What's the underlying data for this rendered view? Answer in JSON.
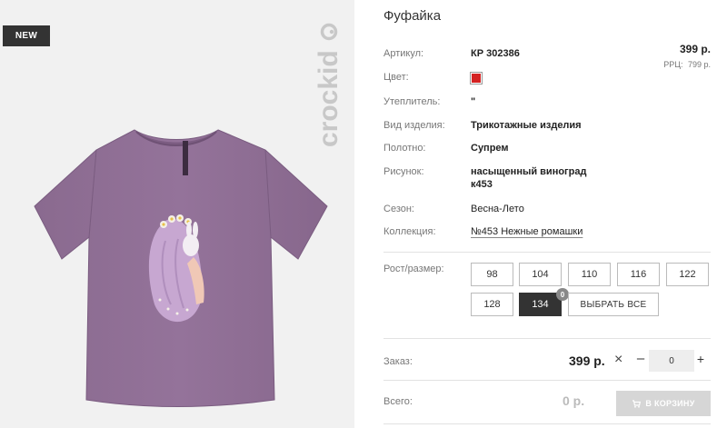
{
  "product": {
    "badge": "NEW",
    "brand": "crockid",
    "title": "Фуфайка",
    "price": "399 р.",
    "rrp_label": "РРЦ:",
    "rrp_value": "799 р."
  },
  "attributes": {
    "article": {
      "label": "Артикул:",
      "value": "КР 302386"
    },
    "color": {
      "label": "Цвет:",
      "swatch": "#d42222"
    },
    "insulation": {
      "label": "Утеплитель:",
      "value": "\""
    },
    "type": {
      "label": "Вид изделия:",
      "value": "Трикотажные изделия"
    },
    "fabric": {
      "label": "Полотно:",
      "value": "Супрем"
    },
    "print": {
      "label": "Рисунок:",
      "value_line1": "насыщенный виноград",
      "value_line2": "к453"
    },
    "season": {
      "label": "Сезон:",
      "value": "Весна-Лето"
    },
    "collection": {
      "label": "Коллекция:",
      "value": "№453 Нежные ромашки"
    }
  },
  "sizes": {
    "label": "Рост/размер:",
    "options": [
      "98",
      "104",
      "110",
      "116",
      "122",
      "128",
      "134"
    ],
    "selected": "134",
    "selected_count": "0",
    "select_all": "ВЫБРАТЬ ВСЕ"
  },
  "order": {
    "label": "Заказ:",
    "price": "399 р.",
    "multiply": "×",
    "minus": "–",
    "quantity": "0",
    "plus": "+"
  },
  "total": {
    "label": "Всего:",
    "value": "0 р.",
    "cart_button": "В КОРЗИНУ"
  },
  "icons": {
    "cart": "cart-icon",
    "brand_logo": "crockid-logo"
  }
}
